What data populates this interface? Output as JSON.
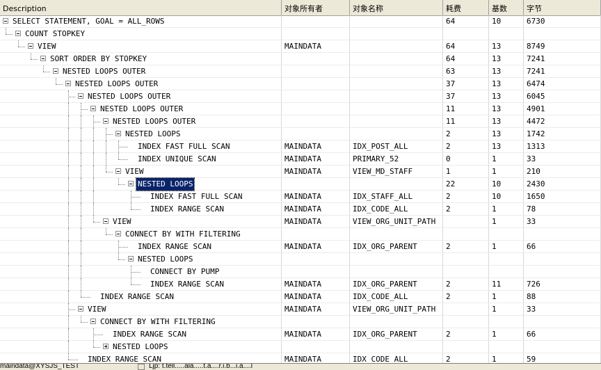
{
  "columns": [
    "Description",
    "对象所有者",
    "对象名称",
    "耗费",
    "基数",
    "字节"
  ],
  "rows": [
    {
      "desc": "SELECT STATEMENT, GOAL = ALL_ROWS",
      "depth": 0,
      "exp": "minus",
      "owner": "",
      "object": "",
      "cost": "64",
      "card": "10",
      "bytes": "6730"
    },
    {
      "desc": "COUNT STOPKEY",
      "depth": 1,
      "exp": "minus",
      "owner": "",
      "object": "",
      "cost": "",
      "card": "",
      "bytes": ""
    },
    {
      "desc": "VIEW",
      "depth": 2,
      "exp": "minus",
      "owner": "MAINDATA",
      "object": "",
      "cost": "64",
      "card": "13",
      "bytes": "8749"
    },
    {
      "desc": "SORT ORDER BY STOPKEY",
      "depth": 3,
      "exp": "minus",
      "owner": "",
      "object": "",
      "cost": "64",
      "card": "13",
      "bytes": "7241"
    },
    {
      "desc": "NESTED LOOPS OUTER",
      "depth": 4,
      "exp": "minus",
      "owner": "",
      "object": "",
      "cost": "63",
      "card": "13",
      "bytes": "7241"
    },
    {
      "desc": "NESTED LOOPS OUTER",
      "depth": 5,
      "exp": "minus",
      "owner": "",
      "object": "",
      "cost": "37",
      "card": "13",
      "bytes": "6474"
    },
    {
      "desc": "NESTED LOOPS OUTER",
      "depth": 6,
      "exp": "minus",
      "owner": "",
      "object": "",
      "cost": "37",
      "card": "13",
      "bytes": "6045"
    },
    {
      "desc": "NESTED LOOPS OUTER",
      "depth": 7,
      "exp": "minus",
      "owner": "",
      "object": "",
      "cost": "11",
      "card": "13",
      "bytes": "4901"
    },
    {
      "desc": "NESTED LOOPS OUTER",
      "depth": 8,
      "exp": "minus",
      "owner": "",
      "object": "",
      "cost": "11",
      "card": "13",
      "bytes": "4472"
    },
    {
      "desc": "NESTED LOOPS",
      "depth": 9,
      "exp": "minus",
      "owner": "",
      "object": "",
      "cost": "2",
      "card": "13",
      "bytes": "1742"
    },
    {
      "desc": "INDEX FAST FULL SCAN",
      "depth": 10,
      "exp": "",
      "owner": "MAINDATA",
      "object": "IDX_POST_ALL",
      "cost": "2",
      "card": "13",
      "bytes": "1313"
    },
    {
      "desc": "INDEX UNIQUE SCAN",
      "depth": 10,
      "exp": "",
      "owner": "MAINDATA",
      "object": "PRIMARY_52",
      "cost": "0",
      "card": "1",
      "bytes": "33"
    },
    {
      "desc": "VIEW",
      "depth": 9,
      "exp": "minus",
      "owner": "MAINDATA",
      "object": "VIEW_MD_STAFF",
      "cost": "1",
      "card": "1",
      "bytes": "210"
    },
    {
      "desc": "NESTED LOOPS",
      "depth": 10,
      "exp": "minus",
      "owner": "",
      "object": "",
      "cost": "22",
      "card": "10",
      "bytes": "2430",
      "selected": true
    },
    {
      "desc": "INDEX FAST FULL SCAN",
      "depth": 11,
      "exp": "",
      "owner": "MAINDATA",
      "object": "IDX_STAFF_ALL",
      "cost": "2",
      "card": "10",
      "bytes": "1650"
    },
    {
      "desc": "INDEX RANGE SCAN",
      "depth": 11,
      "exp": "",
      "owner": "MAINDATA",
      "object": "IDX_CODE_ALL",
      "cost": "2",
      "card": "1",
      "bytes": "78"
    },
    {
      "desc": "VIEW",
      "depth": 8,
      "exp": "minus",
      "owner": "MAINDATA",
      "object": "VIEW_ORG_UNIT_PATH",
      "cost": "",
      "card": "1",
      "bytes": "33"
    },
    {
      "desc": "CONNECT BY WITH FILTERING",
      "depth": 9,
      "exp": "minus",
      "owner": "",
      "object": "",
      "cost": "",
      "card": "",
      "bytes": ""
    },
    {
      "desc": "INDEX RANGE SCAN",
      "depth": 10,
      "exp": "",
      "owner": "MAINDATA",
      "object": "IDX_ORG_PARENT",
      "cost": "2",
      "card": "1",
      "bytes": "66"
    },
    {
      "desc": "NESTED LOOPS",
      "depth": 10,
      "exp": "minus",
      "owner": "",
      "object": "",
      "cost": "",
      "card": "",
      "bytes": ""
    },
    {
      "desc": "CONNECT BY PUMP",
      "depth": 11,
      "exp": "",
      "owner": "",
      "object": "",
      "cost": "",
      "card": "",
      "bytes": ""
    },
    {
      "desc": "INDEX RANGE SCAN",
      "depth": 11,
      "exp": "",
      "owner": "MAINDATA",
      "object": "IDX_ORG_PARENT",
      "cost": "2",
      "card": "11",
      "bytes": "726"
    },
    {
      "desc": "INDEX RANGE SCAN",
      "depth": 7,
      "exp": "",
      "owner": "MAINDATA",
      "object": "IDX_CODE_ALL",
      "cost": "2",
      "card": "1",
      "bytes": "88"
    },
    {
      "desc": "VIEW",
      "depth": 6,
      "exp": "minus",
      "owner": "MAINDATA",
      "object": "VIEW_ORG_UNIT_PATH",
      "cost": "",
      "card": "1",
      "bytes": "33"
    },
    {
      "desc": "CONNECT BY WITH FILTERING",
      "depth": 7,
      "exp": "minus",
      "owner": "",
      "object": "",
      "cost": "",
      "card": "",
      "bytes": ""
    },
    {
      "desc": "INDEX RANGE SCAN",
      "depth": 8,
      "exp": "",
      "owner": "MAINDATA",
      "object": "IDX_ORG_PARENT",
      "cost": "2",
      "card": "1",
      "bytes": "66"
    },
    {
      "desc": "NESTED LOOPS",
      "depth": 8,
      "exp": "plus",
      "owner": "",
      "object": "",
      "cost": "",
      "card": "",
      "bytes": ""
    },
    {
      "desc": "INDEX RANGE SCAN",
      "depth": 6,
      "exp": "",
      "owner": "MAINDATA",
      "object": "IDX_CODE_ALL",
      "cost": "2",
      "card": "1",
      "bytes": "59"
    }
  ],
  "status": {
    "connection": "maindata@XYSJS_TEST",
    "message": "Ljp: t.tell.....ala.....t.a....r.i.b...i.a....l"
  }
}
